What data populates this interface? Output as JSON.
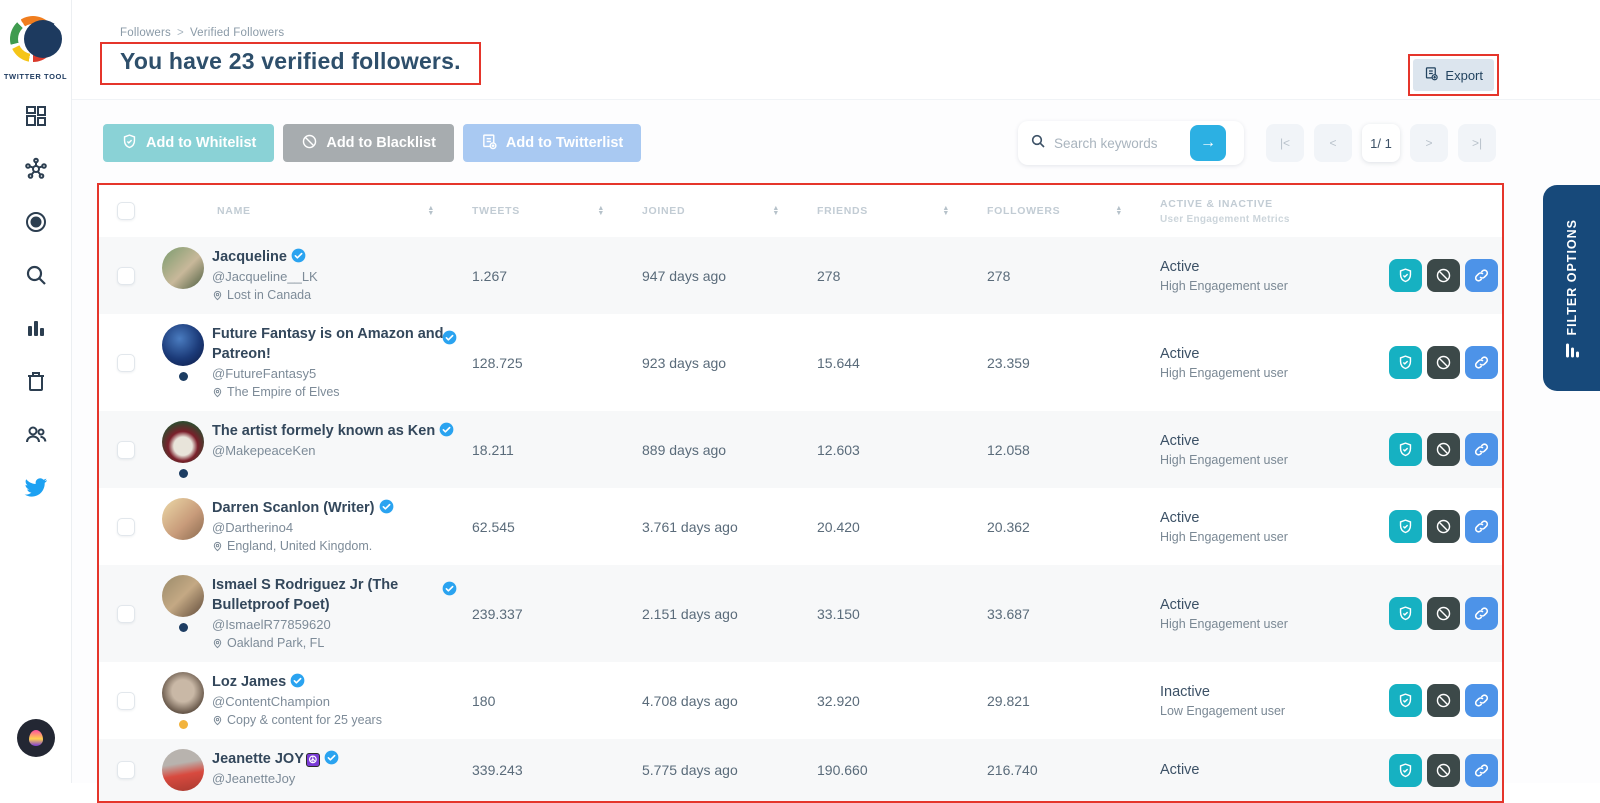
{
  "app": {
    "logo_text": "TWITTER TOOL"
  },
  "sidebar": {
    "items": [
      {
        "icon": "dashboard-icon"
      },
      {
        "icon": "network-icon"
      },
      {
        "icon": "target-icon"
      },
      {
        "icon": "search-icon"
      },
      {
        "icon": "bar-chart-icon"
      },
      {
        "icon": "trash-icon"
      },
      {
        "icon": "users-icon"
      },
      {
        "icon": "twitter-bird-icon"
      }
    ]
  },
  "breadcrumb": {
    "items": [
      "Followers",
      "Verified Followers"
    ],
    "separator": ">"
  },
  "header": {
    "title": "You have 23 verified followers.",
    "export_label": "Export"
  },
  "toolbar": {
    "whitelist_label": "Add to Whitelist",
    "blacklist_label": "Add to Blacklist",
    "twitterlist_label": "Add to Twitterlist",
    "search_placeholder": "Search keywords",
    "search_value": "",
    "search_go_label": "→",
    "pagination": {
      "items": [
        {
          "label": "|<"
        },
        {
          "label": "<"
        },
        {
          "label": "1/ 1",
          "current": true
        },
        {
          "label": ">"
        },
        {
          "label": ">|"
        }
      ]
    }
  },
  "table": {
    "headers": [
      {
        "label": "NAME",
        "sortable": true
      },
      {
        "label": "TWEETS",
        "sortable": true
      },
      {
        "label": "JOINED",
        "sortable": true
      },
      {
        "label": "FRIENDS",
        "sortable": true
      },
      {
        "label": "FOLLOWERS",
        "sortable": true
      }
    ],
    "engagement_header": {
      "line1": "ACTIVE & INACTIVE",
      "line2": "User Engagement Metrics"
    },
    "rows": [
      {
        "name": "Jacqueline",
        "handle": "@Jacqueline__LK",
        "location": "Lost in Canada",
        "tweets": "1.267",
        "joined": "947 days ago",
        "friends": "278",
        "followers": "278",
        "status": "Active",
        "engagement": "High Engagement user",
        "avatar": "a1",
        "dot": ""
      },
      {
        "name": "Future Fantasy is on Amazon and Patreon!",
        "handle": "@FutureFantasy5",
        "location": "The Empire of Elves",
        "tweets": "128.725",
        "joined": "923 days ago",
        "friends": "15.644",
        "followers": "23.359",
        "status": "Active",
        "engagement": "High Engagement user",
        "avatar": "a2",
        "dot": "navy",
        "badge_top_right": true
      },
      {
        "name": "The artist formely known as Ken",
        "handle": "@MakepeaceKen",
        "location": "",
        "tweets": "18.211",
        "joined": "889 days ago",
        "friends": "12.603",
        "followers": "12.058",
        "status": "Active",
        "engagement": "High Engagement user",
        "avatar": "a3",
        "dot": "navy"
      },
      {
        "name": "Darren Scanlon (Writer)",
        "handle": "@Dartherino4",
        "location": "England, United Kingdom.",
        "tweets": "62.545",
        "joined": "3.761 days ago",
        "friends": "20.420",
        "followers": "20.362",
        "status": "Active",
        "engagement": "High Engagement user",
        "avatar": "a4",
        "dot": ""
      },
      {
        "name": "Ismael S Rodriguez Jr (The Bulletproof Poet)",
        "handle": "@IsmaelR77859620",
        "location": "Oakland Park, FL",
        "tweets": "239.337",
        "joined": "2.151 days ago",
        "friends": "33.150",
        "followers": "33.687",
        "status": "Active",
        "engagement": "High Engagement user",
        "avatar": "a5",
        "dot": "navy",
        "badge_top_right": true
      },
      {
        "name": "Loz James",
        "handle": "@ContentChampion",
        "location": "Copy & content for 25 years",
        "tweets": "180",
        "joined": "4.708 days ago",
        "friends": "32.920",
        "followers": "29.821",
        "status": "Inactive",
        "engagement": "Low Engagement user",
        "avatar": "a6",
        "dot": "amber"
      },
      {
        "name": "Jeanette JOY",
        "name_emoji": "☮",
        "handle": "@JeanetteJoy",
        "location": "",
        "tweets": "339.243",
        "joined": "5.775 days ago",
        "friends": "190.660",
        "followers": "216.740",
        "status": "Active",
        "engagement": "",
        "avatar": "a7",
        "dot": ""
      }
    ]
  },
  "filter_panel": {
    "label": "FILTER OPTIONS",
    "icon": "filter-icon"
  },
  "colors": {
    "annotation_red": "#e5352b",
    "accent_teal": "#16b1c2",
    "accent_blue": "#4d93e8",
    "action_dark": "#3c4949",
    "filter_navy": "#17497a",
    "twitter_blue": "#1da1f2",
    "verified_blue": "#2aa3f0",
    "row_stripe": "#f7f8f9"
  }
}
